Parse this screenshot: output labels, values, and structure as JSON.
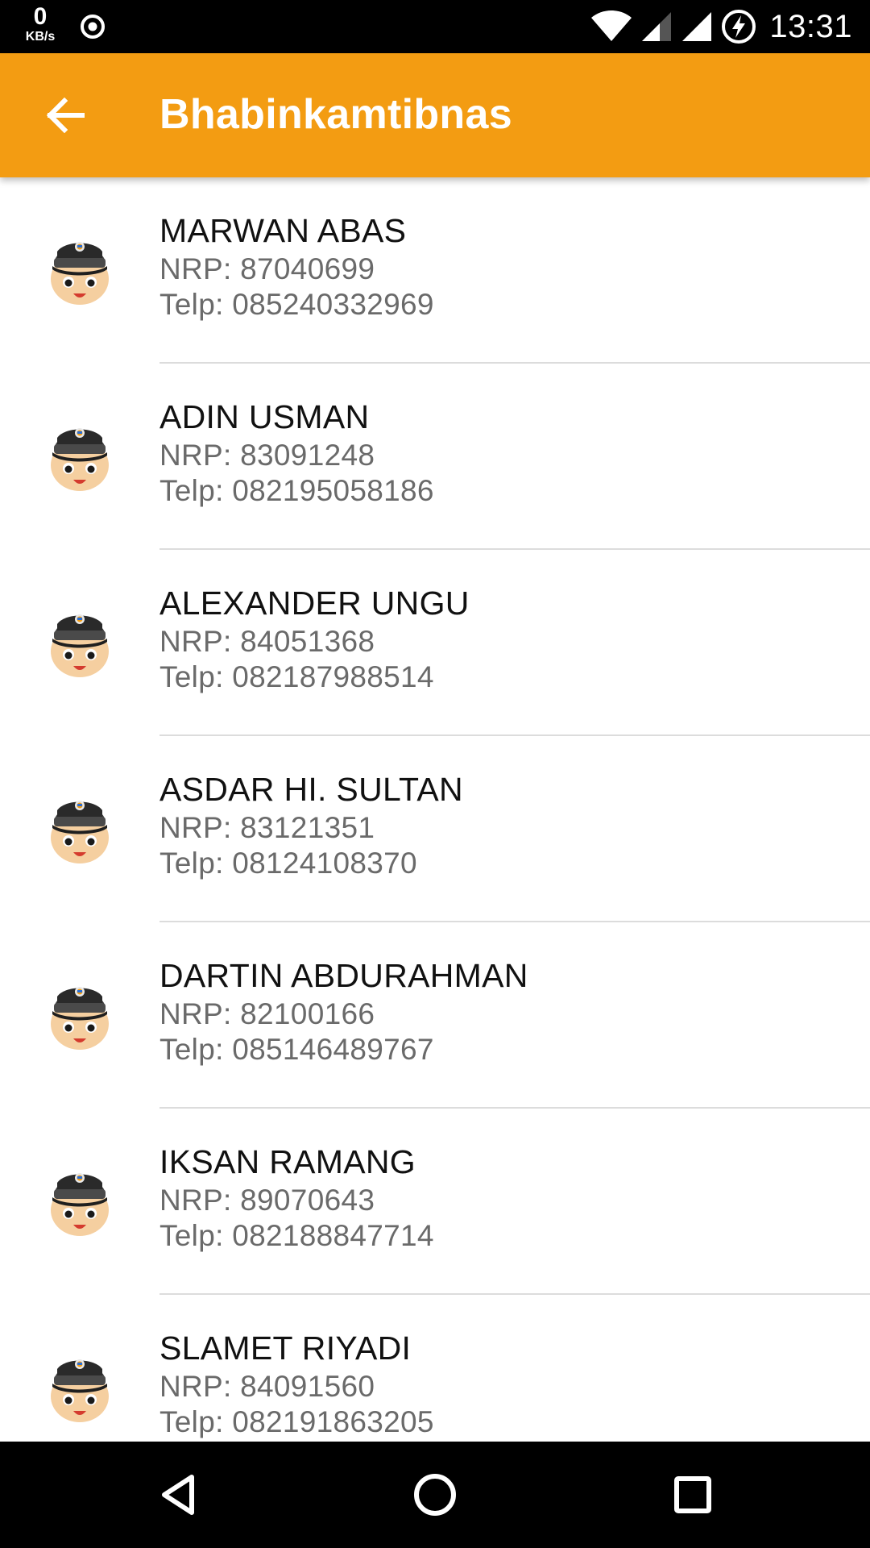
{
  "status_bar": {
    "net_speed_value": "0",
    "net_speed_unit": "KB/s",
    "time": "13:31",
    "icons": [
      "sync-icon",
      "wifi-icon",
      "signal-icon",
      "signal-icon",
      "battery-charging-icon"
    ]
  },
  "app_bar": {
    "title": "Bhabinkamtibnas",
    "back_icon": "arrow-back-icon",
    "color": "#F39C12"
  },
  "personnel": [
    {
      "name": "MARWAN ABAS",
      "nrp": "NRP: 87040699",
      "telp": "Telp: 085240332969"
    },
    {
      "name": "ADIN USMAN",
      "nrp": "NRP: 83091248",
      "telp": "Telp: 082195058186"
    },
    {
      "name": "ALEXANDER UNGU",
      "nrp": "NRP: 84051368",
      "telp": "Telp: 082187988514"
    },
    {
      "name": "ASDAR HI. SULTAN",
      "nrp": "NRP: 83121351",
      "telp": "Telp: 08124108370"
    },
    {
      "name": "DARTIN ABDURAHMAN",
      "nrp": "NRP: 82100166",
      "telp": "Telp: 085146489767"
    },
    {
      "name": "IKSAN RAMANG",
      "nrp": "NRP: 89070643",
      "telp": "Telp: 082188847714"
    },
    {
      "name": "SLAMET RIYADI",
      "nrp": "NRP: 84091560",
      "telp": "Telp: 082191863205"
    }
  ],
  "nav_bar": {
    "icons": [
      "nav-back-icon",
      "nav-home-icon",
      "nav-recents-icon"
    ]
  }
}
